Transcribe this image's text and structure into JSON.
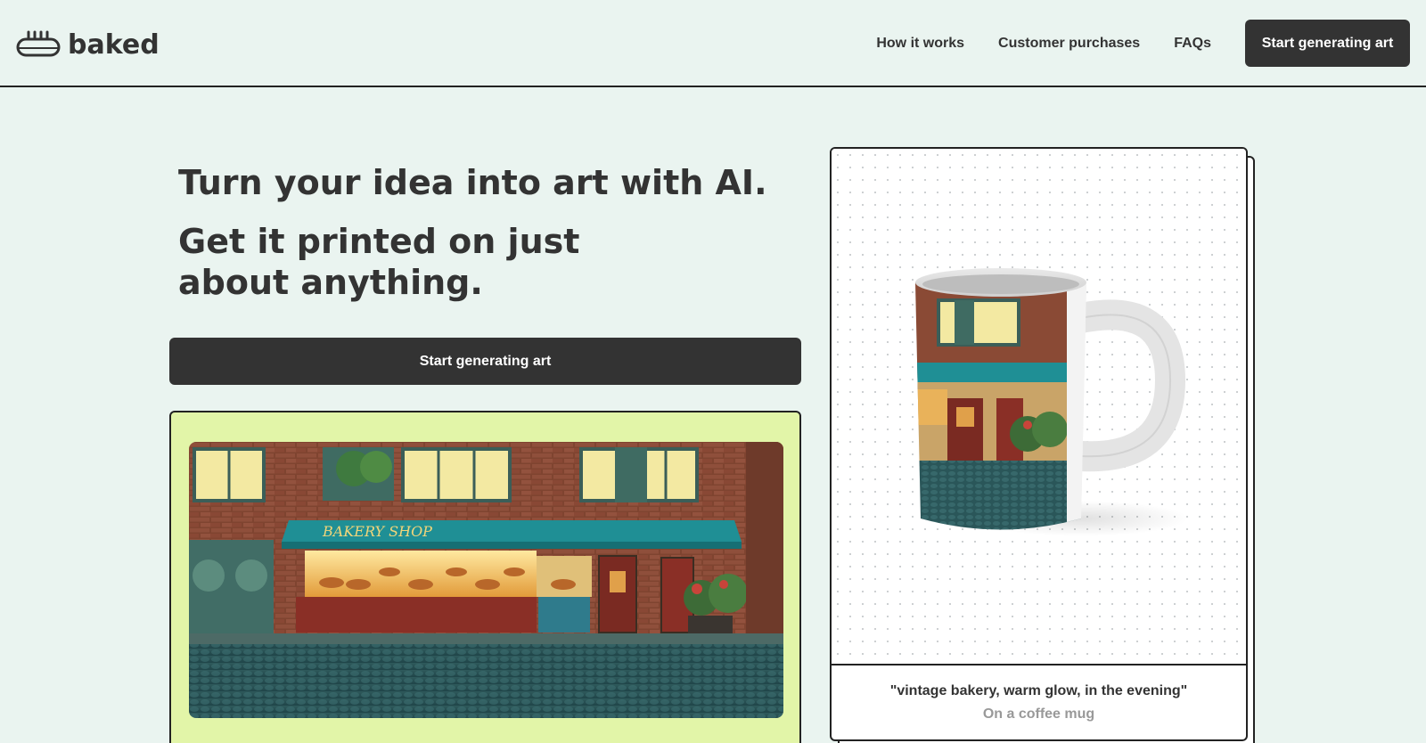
{
  "header": {
    "logo_text": "baked",
    "nav": {
      "how_it_works": "How it works",
      "customer_purchases": "Customer purchases",
      "faqs": "FAQs",
      "cta": "Start generating art"
    }
  },
  "hero": {
    "headline_1": "Turn your idea into art with AI.",
    "headline_2": "Get it printed on just about anything.",
    "cta": "Start generating art"
  },
  "showcase": {
    "bakery_sign": "BAKERY SHOP",
    "prompt": "\"vintage bakery, warm glow, in the evening\"",
    "product": "On a coffee mug"
  },
  "colors": {
    "background": "#eaf4f0",
    "dark": "#333333",
    "card_lime": "#e2f5a8",
    "muted_text": "#999999"
  }
}
